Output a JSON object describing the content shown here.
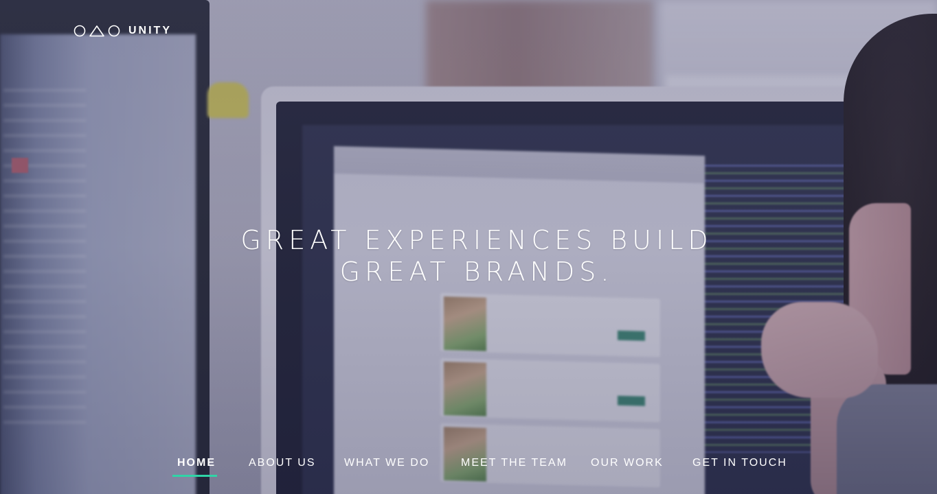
{
  "brand": {
    "name": "UNITY",
    "logo_icons": [
      "circle-icon",
      "triangle-icon",
      "circle-icon"
    ]
  },
  "hero": {
    "headline_line1": "GREAT EXPERIENCES BUILD",
    "headline_line2": "GREAT BRANDS."
  },
  "nav": {
    "items": [
      {
        "label": "HOME",
        "active": true
      },
      {
        "label": "ABOUT US",
        "active": false
      },
      {
        "label": "WHAT WE DO",
        "active": false
      },
      {
        "label": "MEET THE TEAM",
        "active": false
      },
      {
        "label": "OUR WORK",
        "active": false
      },
      {
        "label": "GET IN TOUCH",
        "active": false
      }
    ],
    "accent_color": "#2fd5a7"
  }
}
